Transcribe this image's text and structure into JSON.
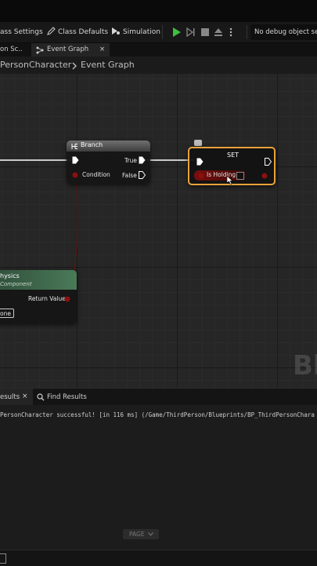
{
  "toolbar": {
    "class_settings_label": "ass Settings",
    "class_defaults_label": "Class Defaults",
    "simulation_label": "Simulation",
    "debug_select_value": "No debug object selec"
  },
  "tabs": [
    {
      "label": "on Sc.."
    },
    {
      "label": "Event Graph",
      "close": "×"
    }
  ],
  "breadcrumb": {
    "parent": "PersonCharacter",
    "separator": ">",
    "current": "Event Graph"
  },
  "nodes": {
    "branch": {
      "title": "Branch",
      "condition_label": "Condition",
      "true_label": "True",
      "false_label": "False"
    },
    "set": {
      "title": "SET",
      "variable_label": "Is Holding"
    },
    "physics": {
      "title": "hysics",
      "subtitle": "Component",
      "return_label": "Return Value",
      "input_value": "one"
    }
  },
  "watermark": "Bl",
  "bottom_tabs": {
    "results_label": "esults",
    "results_close": "×",
    "find_results_label": "Find Results"
  },
  "log": {
    "line": "PersonCharacter successful! [in 116 ms] (/Game/ThirdPerson/Blueprints/BP_ThirdPersonChara"
  },
  "page_button": "PAGE",
  "colors": {
    "exec": "#ffffff",
    "bool": "#8e0f0f",
    "set_border": "#e8a23a",
    "play": "#3fbf3f",
    "physics_header": "#3b6a4b"
  }
}
